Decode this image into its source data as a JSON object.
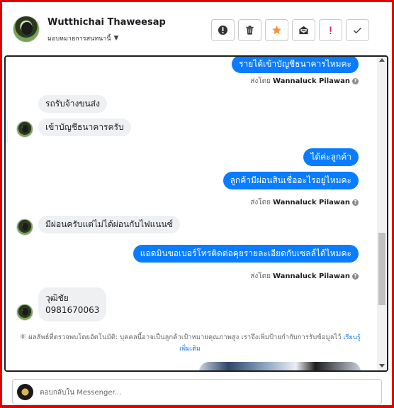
{
  "header": {
    "contact_name": "Wutthichai Thaweesap",
    "assign_label": "มอบหมายการสนทนานี้",
    "actions": [
      {
        "name": "mark-spam-button",
        "icon": "alert-circle-icon"
      },
      {
        "name": "delete-button",
        "icon": "trash-icon"
      },
      {
        "name": "star-button",
        "icon": "star-icon"
      },
      {
        "name": "mark-unread-button",
        "icon": "envelope-open-icon"
      },
      {
        "name": "follow-up-button",
        "icon": "exclamation-icon"
      },
      {
        "name": "mark-done-button",
        "icon": "check-icon"
      }
    ]
  },
  "colors": {
    "outgoing": "#0a7cff",
    "incoming": "#eef0f2",
    "star": "#f7923a",
    "link": "#1877f2",
    "frame": "#e00000"
  },
  "thread": {
    "messages": [
      {
        "dir": "out",
        "text": "รายได้เข้าบัญชีธนาคารไหมคะ"
      },
      {
        "dir": "in",
        "text": "รถรับจ้างขนส่ง"
      },
      {
        "dir": "in",
        "text": "เข้าบัญชีธนาคารครับ"
      },
      {
        "dir": "out",
        "text": "ได้ค่ะลูกค้า"
      },
      {
        "dir": "out",
        "text": "ลูกค้ามีผ่อนสินเชื่ออะไรอยู่ไหมคะ"
      },
      {
        "dir": "in",
        "text": "มีผ่อนครับแต่ไม่ได้ผ่อนกับไฟแนนซ์"
      },
      {
        "dir": "out",
        "text": "แอดมินขอเบอร์โทรติดต่อคุยรายละเอียดกับเซลล์ได้ไหมคะ"
      },
      {
        "dir": "in",
        "text": "วุฒิชัย"
      },
      {
        "dir": "in",
        "text": "0981670063"
      }
    ],
    "sent_by_prefix": "ส่งโดย",
    "sender": "Wannaluck Pilawan",
    "help_glyph": "?",
    "auto_note": {
      "title": "ผลลัพธ์ที่ตรวจพบโดยอัตโนมัติ:",
      "text": "บุคคลนี้อาจเป็นลูกค้าเป้าหมายคุณภาพสูง เราจึงเพิ่มป้ายกำกับการรับข้อมูลไว้",
      "link": "เรียนรู้เพิ่มเติม"
    }
  },
  "composer": {
    "placeholder": "ตอบกลับใน Messenger..."
  }
}
